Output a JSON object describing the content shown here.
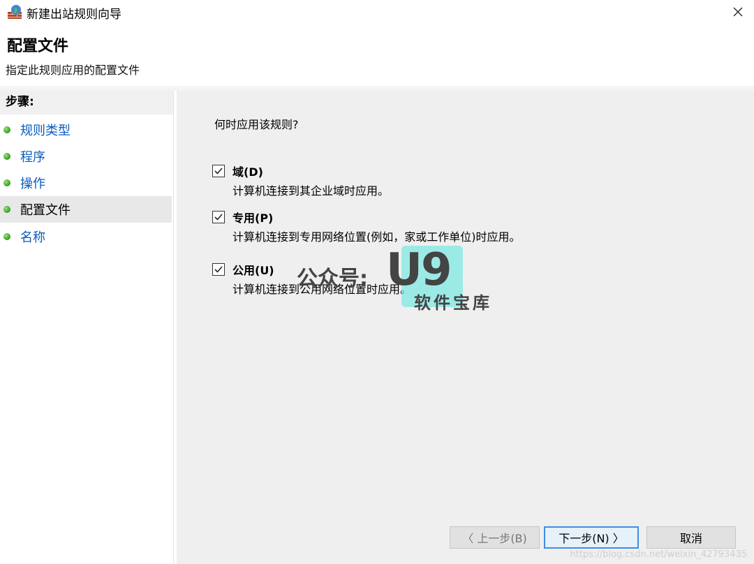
{
  "window": {
    "title": "新建出站规则向导",
    "icon": "firewall-globe-icon",
    "close_icon": "close-icon"
  },
  "header": {
    "title": "配置文件",
    "subtitle": "指定此规则应用的配置文件"
  },
  "sidebar": {
    "steps_label": "步骤:",
    "items": [
      {
        "label": "规则类型",
        "active": false
      },
      {
        "label": "程序",
        "active": false
      },
      {
        "label": "操作",
        "active": false
      },
      {
        "label": "配置文件",
        "active": true
      },
      {
        "label": "名称",
        "active": false
      }
    ]
  },
  "main": {
    "question": "何时应用该规则?",
    "options": [
      {
        "title": "域(D)",
        "description": "计算机连接到其企业域时应用。",
        "checked": true
      },
      {
        "title": "专用(P)",
        "description": "计算机连接到专用网络位置(例如，家或工作单位)时应用。",
        "checked": true
      },
      {
        "title": "公用(U)",
        "description": "计算机连接到公用网络位置时应用。",
        "checked": true
      }
    ]
  },
  "buttons": {
    "back": "上一步(B)",
    "next": "下一步(N)",
    "cancel": "取消"
  },
  "watermark": {
    "prefix": "公众号:",
    "brand": "U9",
    "sub": "软件宝库",
    "url": "https://blog.csdn.net/weixin_42793435"
  },
  "colors": {
    "link": "#0a5bbf",
    "primary_border": "#3e8fe0",
    "content_bg": "#efefef"
  }
}
